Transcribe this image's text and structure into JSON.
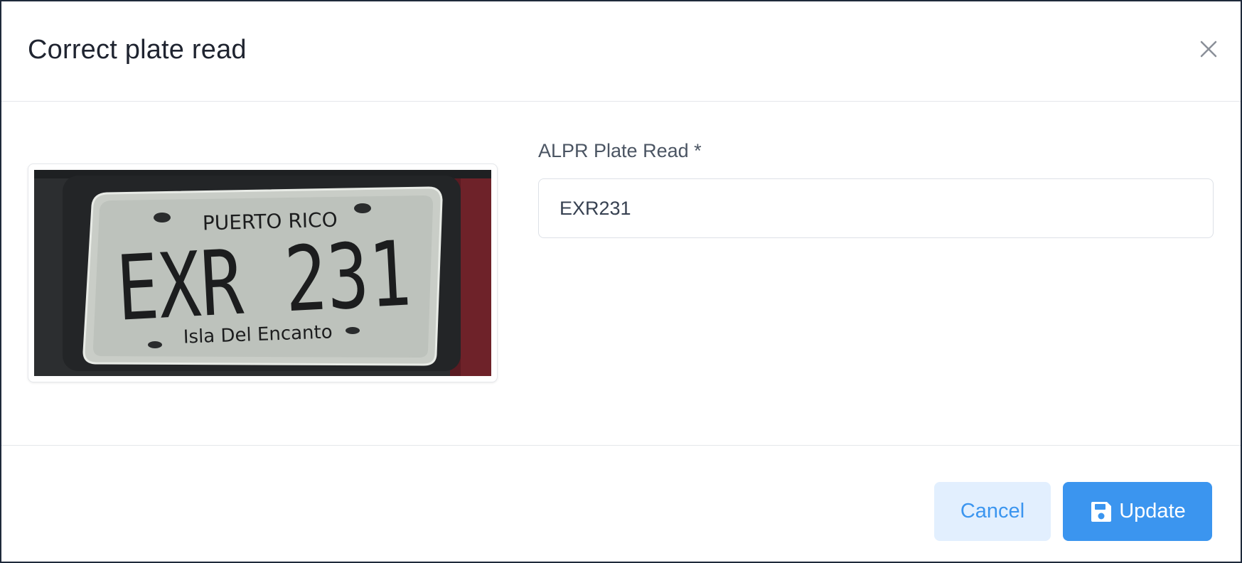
{
  "modal": {
    "title": "Correct plate read"
  },
  "plate_image": {
    "state": "PUERTO RICO",
    "number": "EXR 231",
    "slogan": "Isla Del Encanto"
  },
  "form": {
    "label": "ALPR Plate Read *",
    "value": "EXR231"
  },
  "footer": {
    "cancel_label": "Cancel",
    "update_label": "Update"
  },
  "colors": {
    "primary": "#3b95ef",
    "primary_light": "#e2effe",
    "backdrop": "#1e293b"
  },
  "icons": {
    "close": "close-icon",
    "save": "save-icon"
  }
}
